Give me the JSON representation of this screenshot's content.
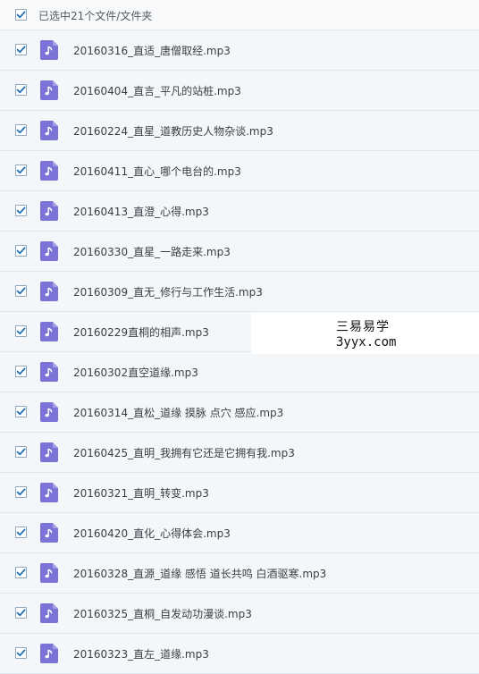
{
  "header": {
    "selection_label": "已选中21个文件/文件夹",
    "select_all_checked": true
  },
  "files": [
    {
      "name": "20160316_直适_唐僧取经.mp3",
      "checked": true,
      "icon": "music-note-icon"
    },
    {
      "name": "20160404_直言_平凡的站桩.mp3",
      "checked": true,
      "icon": "music-note-icon"
    },
    {
      "name": "20160224_直星_道教历史人物杂谈.mp3",
      "checked": true,
      "icon": "music-note-icon"
    },
    {
      "name": "20160411_直心_哪个电台的.mp3",
      "checked": true,
      "icon": "music-note-icon"
    },
    {
      "name": "20160413_直澄_心得.mp3",
      "checked": true,
      "icon": "music-note-icon"
    },
    {
      "name": "20160330_直星_一路走来.mp3",
      "checked": true,
      "icon": "music-note-icon"
    },
    {
      "name": "20160309_直无_修行与工作生活.mp3",
      "checked": true,
      "icon": "music-note-icon"
    },
    {
      "name": "20160229直桐的相声.mp3",
      "checked": true,
      "icon": "music-note-icon"
    },
    {
      "name": "20160302直空道缘.mp3",
      "checked": true,
      "icon": "music-note-icon"
    },
    {
      "name": "20160314_直松_道缘 摸脉 点穴 感应.mp3",
      "checked": true,
      "icon": "music-note-icon"
    },
    {
      "name": "20160425_直明_我拥有它还是它拥有我.mp3",
      "checked": true,
      "icon": "music-note-icon"
    },
    {
      "name": "20160321_直明_转变.mp3",
      "checked": true,
      "icon": "music-note-icon"
    },
    {
      "name": "20160420_直化_心得体会.mp3",
      "checked": true,
      "icon": "music-note-icon"
    },
    {
      "name": "20160328_直源_道缘 感悟 道长共鸣 白酒驱寒.mp3",
      "checked": true,
      "icon": "music-note-icon"
    },
    {
      "name": "20160325_直桐_自发动功漫谈.mp3",
      "checked": true,
      "icon": "music-note-icon"
    },
    {
      "name": "20160323_直左_道缘.mp3",
      "checked": true,
      "icon": "music-note-icon"
    }
  ],
  "watermark": {
    "line1": "三易易学",
    "line2": "3yyx.com"
  },
  "colors": {
    "row_background": "#f4f7fa",
    "row_divider": "#dfe6ed",
    "check_color": "#1f6fb6",
    "file_icon_color": "#7b73d6"
  }
}
